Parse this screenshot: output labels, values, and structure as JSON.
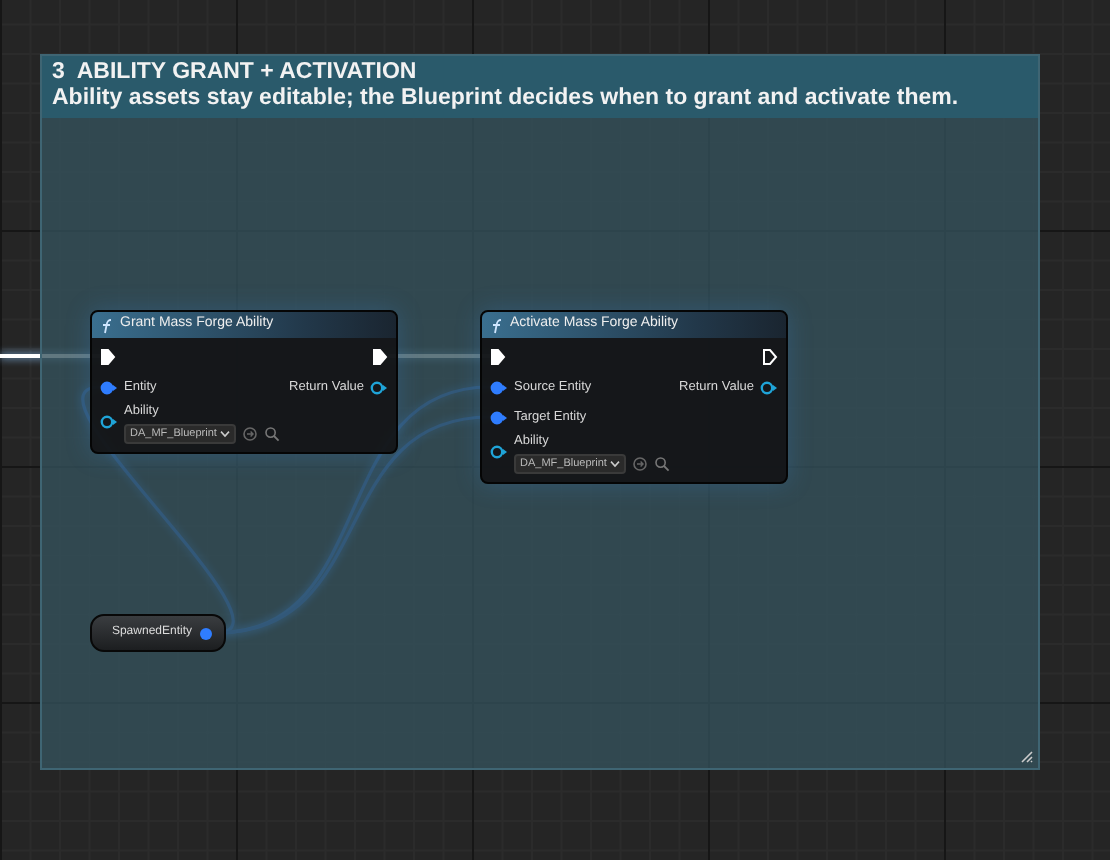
{
  "comment": {
    "title": "3  ABILITY GRANT + ACTIVATION",
    "description": "Ability assets stay editable; the Blueprint decides when to grant and activate them."
  },
  "nodes": [
    {
      "title": "Grant Mass Forge Ability",
      "exec_in_connected": true,
      "exec_out_connected": true,
      "inputs": [
        {
          "label": "Entity",
          "kind": "entity",
          "connected": true
        },
        {
          "label": "Ability",
          "kind": "asset",
          "connected": false,
          "value": "DA_MF_Blueprint"
        }
      ],
      "outputs": [
        {
          "label": "Return Value",
          "connected": false
        }
      ]
    },
    {
      "title": "Activate Mass Forge Ability",
      "exec_in_connected": true,
      "exec_out_connected": false,
      "inputs": [
        {
          "label": "Source Entity",
          "kind": "entity",
          "connected": true
        },
        {
          "label": "Target Entity",
          "kind": "entity",
          "connected": true
        },
        {
          "label": "Ability",
          "kind": "asset",
          "connected": false,
          "value": "DA_MF_Blueprint"
        }
      ],
      "outputs": [
        {
          "label": "Return Value",
          "connected": false
        }
      ]
    }
  ],
  "variables": [
    {
      "label": "SpawnedEntity"
    }
  ]
}
